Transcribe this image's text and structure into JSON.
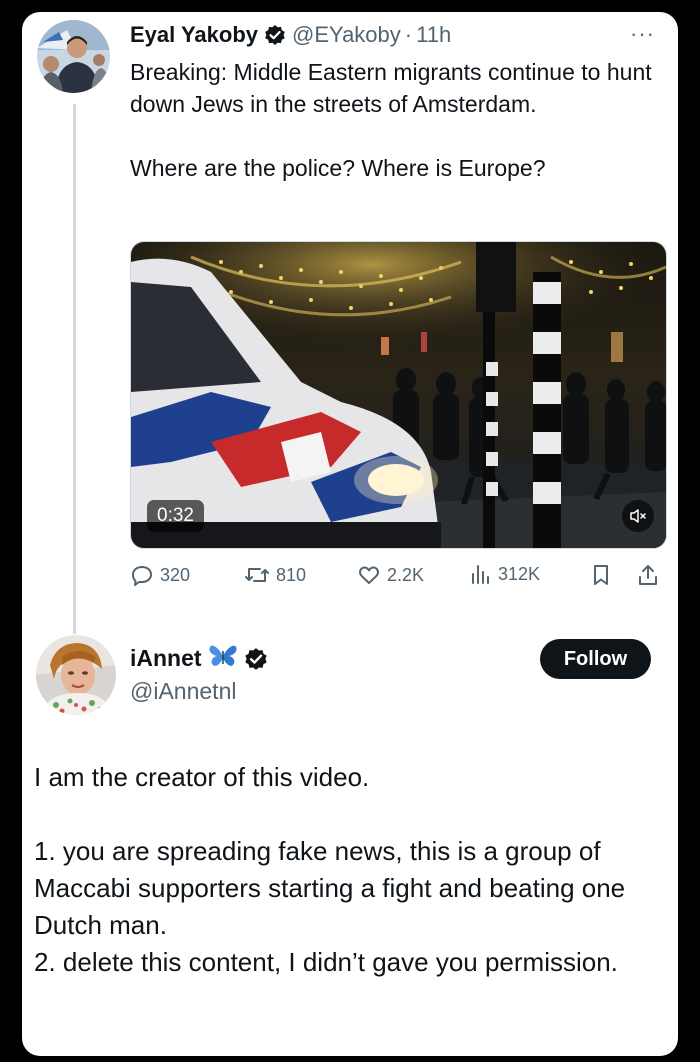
{
  "colors": {
    "verified_blue": "#1d9bf0",
    "text_primary": "#0f1419",
    "text_secondary": "#536471",
    "follow_button_bg": "#0f1419",
    "thread_line": "#cfd9de",
    "butterfly": "#4a90e2"
  },
  "tweet": {
    "author": {
      "display_name": "Eyal Yakoby",
      "handle": "@EYakoby",
      "verified_icon": "verified-badge-icon"
    },
    "separator": "·",
    "time": "11h",
    "more_label": "···",
    "text": "Breaking: Middle Eastern migrants continue to hunt down Jews in the streets of Amsterdam.\n\nWhere are the police? Where is Europe?",
    "media": {
      "duration": "0:32",
      "mute_icon": "volume-muted-icon"
    },
    "metrics": {
      "replies": "320",
      "reposts": "810",
      "likes": "2.2K",
      "views": "312K"
    },
    "action_icons": [
      "reply-icon",
      "repost-icon",
      "like-icon",
      "views-icon",
      "bookmark-icon",
      "share-icon"
    ]
  },
  "reply": {
    "author": {
      "display_name": "iAnnet",
      "handle": "@iAnnetnl",
      "emoji_icon": "butterfly-icon",
      "verified_icon": "verified-badge-icon"
    },
    "follow_label": "Follow",
    "text": "I am the creator of this video.\n\n1. you are spreading fake news, this is a group of Maccabi supporters starting a fight and beating one Dutch man.\n2. delete this content, I didn’t gave you permission."
  }
}
